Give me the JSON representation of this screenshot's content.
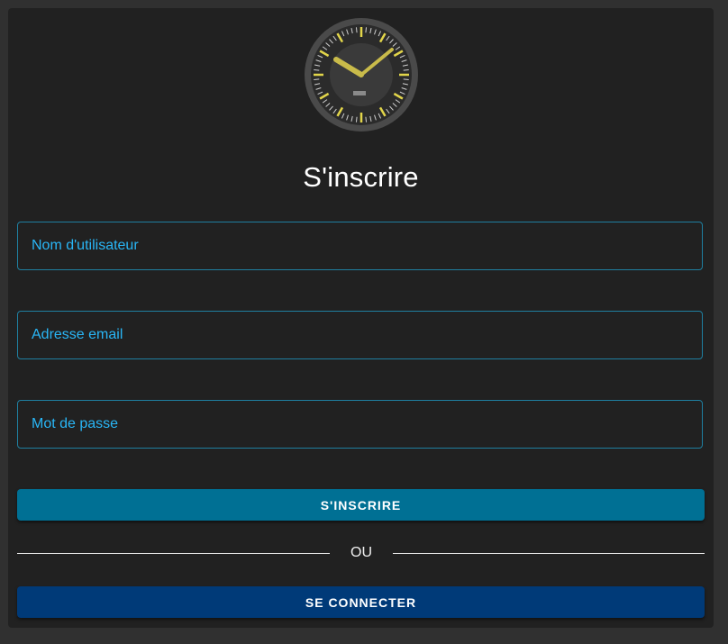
{
  "logo": {
    "icon": "clock-logo-icon",
    "colors": {
      "rim": "#4a4a4a",
      "face": "#2b2b2b",
      "inner": "#3a3a3a",
      "hands": "#c9bb4a",
      "ticks_major": "#e2d54a",
      "ticks_minor": "#cfcfcf"
    }
  },
  "title": "S'inscrire",
  "form": {
    "username": {
      "placeholder": "Nom d'utilisateur",
      "value": ""
    },
    "email": {
      "placeholder": "Adresse email",
      "value": ""
    },
    "password": {
      "placeholder": "Mot de passe",
      "value": ""
    }
  },
  "buttons": {
    "register_label": "S'INSCRIRE",
    "login_label": "SE CONNECTER"
  },
  "divider": {
    "text": "OU"
  },
  "colors": {
    "background": "#303030",
    "card": "#212121",
    "field_border": "#1f7fa0",
    "placeholder": "#29b6f6",
    "register_button": "#007094",
    "login_button": "#003a78"
  }
}
